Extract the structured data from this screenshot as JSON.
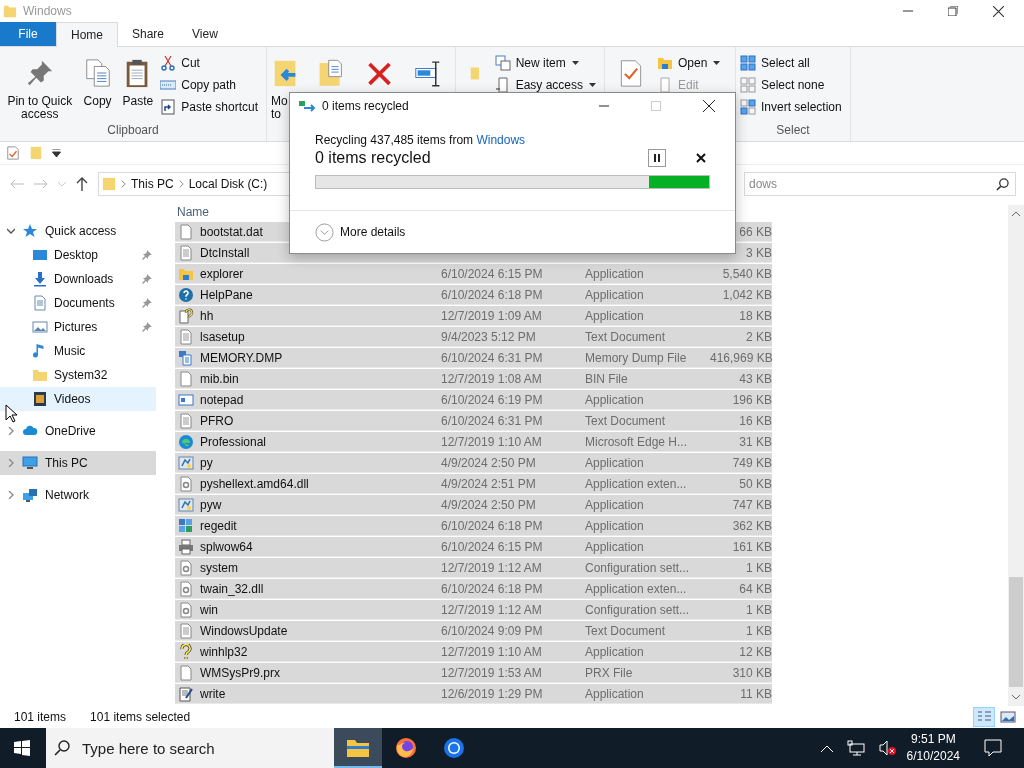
{
  "window": {
    "title": "Windows"
  },
  "ribbon": {
    "tabs": [
      {
        "label": "File",
        "kind": "file",
        "selected": false
      },
      {
        "label": "Home",
        "kind": "tab",
        "selected": true
      },
      {
        "label": "Share",
        "kind": "tab",
        "selected": false
      },
      {
        "label": "View",
        "kind": "tab",
        "selected": false
      }
    ],
    "clipboard": {
      "large": [
        {
          "label": "Pin to Quick access",
          "kind": "pin"
        },
        {
          "label": "Copy",
          "kind": "copy"
        },
        {
          "label": "Paste",
          "kind": "paste"
        }
      ],
      "small": [
        {
          "label": "Cut",
          "kind": "cut"
        },
        {
          "label": "Copy path",
          "kind": "path"
        },
        {
          "label": "Paste shortcut",
          "kind": "shortcut"
        }
      ],
      "label": "Clipboard"
    },
    "organize": {
      "move_label": "Mo to"
    },
    "new": {
      "items": [
        {
          "label": "New item",
          "dropdown": true
        },
        {
          "label": "Easy access",
          "dropdown": true
        }
      ]
    },
    "open": {
      "items": [
        {
          "label": "Open",
          "dropdown": true,
          "disabled": false
        },
        {
          "label": "Edit",
          "dropdown": false,
          "disabled": true
        }
      ]
    },
    "select": {
      "items": [
        {
          "label": "Select all",
          "kind": "all"
        },
        {
          "label": "Select none",
          "kind": "none"
        },
        {
          "label": "Invert selection",
          "kind": "invert"
        }
      ],
      "label": "Select"
    }
  },
  "address": {
    "crumbs": [
      "This PC",
      "Local Disk (C:)"
    ],
    "search_placeholder": "dows"
  },
  "nav": [
    {
      "label": "Quick access",
      "kind": "star",
      "expanded": true,
      "selected": false,
      "hovered": false,
      "children": [
        {
          "label": "Desktop",
          "kind": "desktop",
          "pinned": true,
          "selected": false,
          "hovered": false
        },
        {
          "label": "Downloads",
          "kind": "download",
          "pinned": true,
          "selected": false,
          "hovered": false
        },
        {
          "label": "Documents",
          "kind": "documents",
          "pinned": true,
          "selected": false,
          "hovered": false
        },
        {
          "label": "Pictures",
          "kind": "pictures",
          "pinned": true,
          "selected": false,
          "hovered": false
        },
        {
          "label": "Music",
          "kind": "music",
          "pinned": false,
          "selected": false,
          "hovered": false
        },
        {
          "label": "System32",
          "kind": "folder",
          "pinned": false,
          "selected": false,
          "hovered": false
        },
        {
          "label": "Videos",
          "kind": "videos",
          "pinned": false,
          "selected": false,
          "hovered": true
        }
      ]
    },
    {
      "label": "OneDrive",
      "kind": "cloud",
      "expanded": false,
      "selected": false,
      "hovered": false
    },
    {
      "label": "This PC",
      "kind": "pc",
      "expanded": false,
      "selected": true,
      "hovered": false
    },
    {
      "label": "Network",
      "kind": "network",
      "expanded": false,
      "selected": false,
      "hovered": false
    }
  ],
  "files": {
    "columns": [
      "Name"
    ],
    "rows": [
      {
        "name": "bootstat.dat",
        "kind": "blank",
        "size": "66 KB",
        "selected": true
      },
      {
        "name": "DtcInstall",
        "kind": "text",
        "size": "3 KB",
        "selected": true
      },
      {
        "name": "explorer",
        "kind": "explorer",
        "date": "6/10/2024 6:15 PM",
        "type": "Application",
        "size": "5,540 KB",
        "selected": true
      },
      {
        "name": "HelpPane",
        "kind": "help",
        "date": "6/10/2024 6:18 PM",
        "type": "Application",
        "size": "1,042 KB",
        "selected": true
      },
      {
        "name": "hh",
        "kind": "helpdoc",
        "date": "12/7/2019 1:09 AM",
        "type": "Application",
        "size": "18 KB",
        "selected": true
      },
      {
        "name": "lsasetup",
        "kind": "text",
        "date": "9/4/2023 5:12 PM",
        "type": "Text Document",
        "size": "2 KB",
        "selected": true
      },
      {
        "name": "MEMORY.DMP",
        "kind": "dump",
        "date": "6/10/2024 6:31 PM",
        "type": "Memory Dump File",
        "size": "416,969 KB",
        "selected": true
      },
      {
        "name": "mib.bin",
        "kind": "blank",
        "date": "12/7/2019 1:08 AM",
        "type": "BIN File",
        "size": "43 KB",
        "selected": true
      },
      {
        "name": "notepad",
        "kind": "notepad",
        "date": "6/10/2024 6:19 PM",
        "type": "Application",
        "size": "196 KB",
        "selected": true
      },
      {
        "name": "PFRO",
        "kind": "text",
        "date": "6/10/2024 6:31 PM",
        "type": "Text Document",
        "size": "16 KB",
        "selected": true
      },
      {
        "name": "Professional",
        "kind": "edge",
        "date": "12/7/2019 1:10 AM",
        "type": "Microsoft Edge H...",
        "size": "31 KB",
        "selected": true
      },
      {
        "name": "py",
        "kind": "python",
        "date": "4/9/2024 2:50 PM",
        "type": "Application",
        "size": "749 KB",
        "selected": true
      },
      {
        "name": "pyshellext.amd64.dll",
        "kind": "dll",
        "date": "4/9/2024 2:51 PM",
        "type": "Application exten...",
        "size": "50 KB",
        "selected": true
      },
      {
        "name": "pyw",
        "kind": "python",
        "date": "4/9/2024 2:50 PM",
        "type": "Application",
        "size": "747 KB",
        "selected": true
      },
      {
        "name": "regedit",
        "kind": "regedit",
        "date": "6/10/2024 6:18 PM",
        "type": "Application",
        "size": "362 KB",
        "selected": true
      },
      {
        "name": "splwow64",
        "kind": "printer",
        "date": "6/10/2024 6:15 PM",
        "type": "Application",
        "size": "161 KB",
        "selected": true
      },
      {
        "name": "system",
        "kind": "config",
        "date": "12/7/2019 1:12 AM",
        "type": "Configuration sett...",
        "size": "1 KB",
        "selected": true
      },
      {
        "name": "twain_32.dll",
        "kind": "dll",
        "date": "6/10/2024 6:18 PM",
        "type": "Application exten...",
        "size": "64 KB",
        "selected": true
      },
      {
        "name": "win",
        "kind": "config",
        "date": "12/7/2019 1:12 AM",
        "type": "Configuration sett...",
        "size": "1 KB",
        "selected": true
      },
      {
        "name": "WindowsUpdate",
        "kind": "text",
        "date": "6/10/2024 9:09 PM",
        "type": "Text Document",
        "size": "1 KB",
        "selected": true
      },
      {
        "name": "winhlp32",
        "kind": "question",
        "date": "12/7/2019 1:10 AM",
        "type": "Application",
        "size": "12 KB",
        "selected": true
      },
      {
        "name": "WMSysPr9.prx",
        "kind": "blank",
        "date": "12/7/2019 1:53 AM",
        "type": "PRX File",
        "size": "310 KB",
        "selected": true
      },
      {
        "name": "write",
        "kind": "write",
        "date": "12/6/2019 1:29 PM",
        "type": "Application",
        "size": "11 KB",
        "selected": true
      }
    ]
  },
  "status_bar": {
    "count": "101 items",
    "selection": "101 items selected",
    "details_view_selected": true
  },
  "dialog": {
    "title": "0 items recycled",
    "message": "Recycling 437,485 items from ",
    "link": "Windows",
    "status": "0 items recycled",
    "details": "More details",
    "maximize_disabled": true,
    "indeterminate": true
  },
  "taskbar": {
    "search_placeholder": "Type here to search",
    "apps": [
      {
        "kind": "explorer",
        "active": true
      },
      {
        "kind": "firefox",
        "active": false
      },
      {
        "kind": "browser",
        "active": false
      }
    ],
    "volume_muted": true,
    "time": "9:51 PM",
    "date": "6/10/2024"
  }
}
